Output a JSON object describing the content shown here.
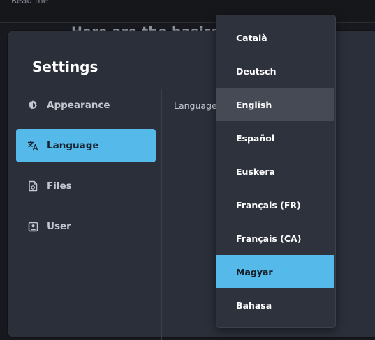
{
  "background": {
    "readme_text": "Read me",
    "heading_text": "Here are the basics"
  },
  "settings": {
    "title": "Settings",
    "nav": [
      {
        "label": "Appearance",
        "icon": "gear-icon",
        "active": false
      },
      {
        "label": "Language",
        "icon": "translate-icon",
        "active": true
      },
      {
        "label": "Files",
        "icon": "file-icon",
        "active": false
      },
      {
        "label": "User",
        "icon": "user-icon",
        "active": false
      }
    ],
    "language_field_label": "Language"
  },
  "dropdown": {
    "options": [
      {
        "label": "Català"
      },
      {
        "label": "Deutsch"
      },
      {
        "label": "English",
        "state": "hovered"
      },
      {
        "label": "Español"
      },
      {
        "label": "Euskera"
      },
      {
        "label": "Français (FR)"
      },
      {
        "label": "Français (CA)"
      },
      {
        "label": "Magyar",
        "state": "selected"
      },
      {
        "label": "Bahasa"
      }
    ]
  },
  "colors": {
    "accent": "#55b9ea",
    "modal_bg": "#2a2f39",
    "dropdown_bg": "#2d323c",
    "hover_bg": "#454a55"
  }
}
